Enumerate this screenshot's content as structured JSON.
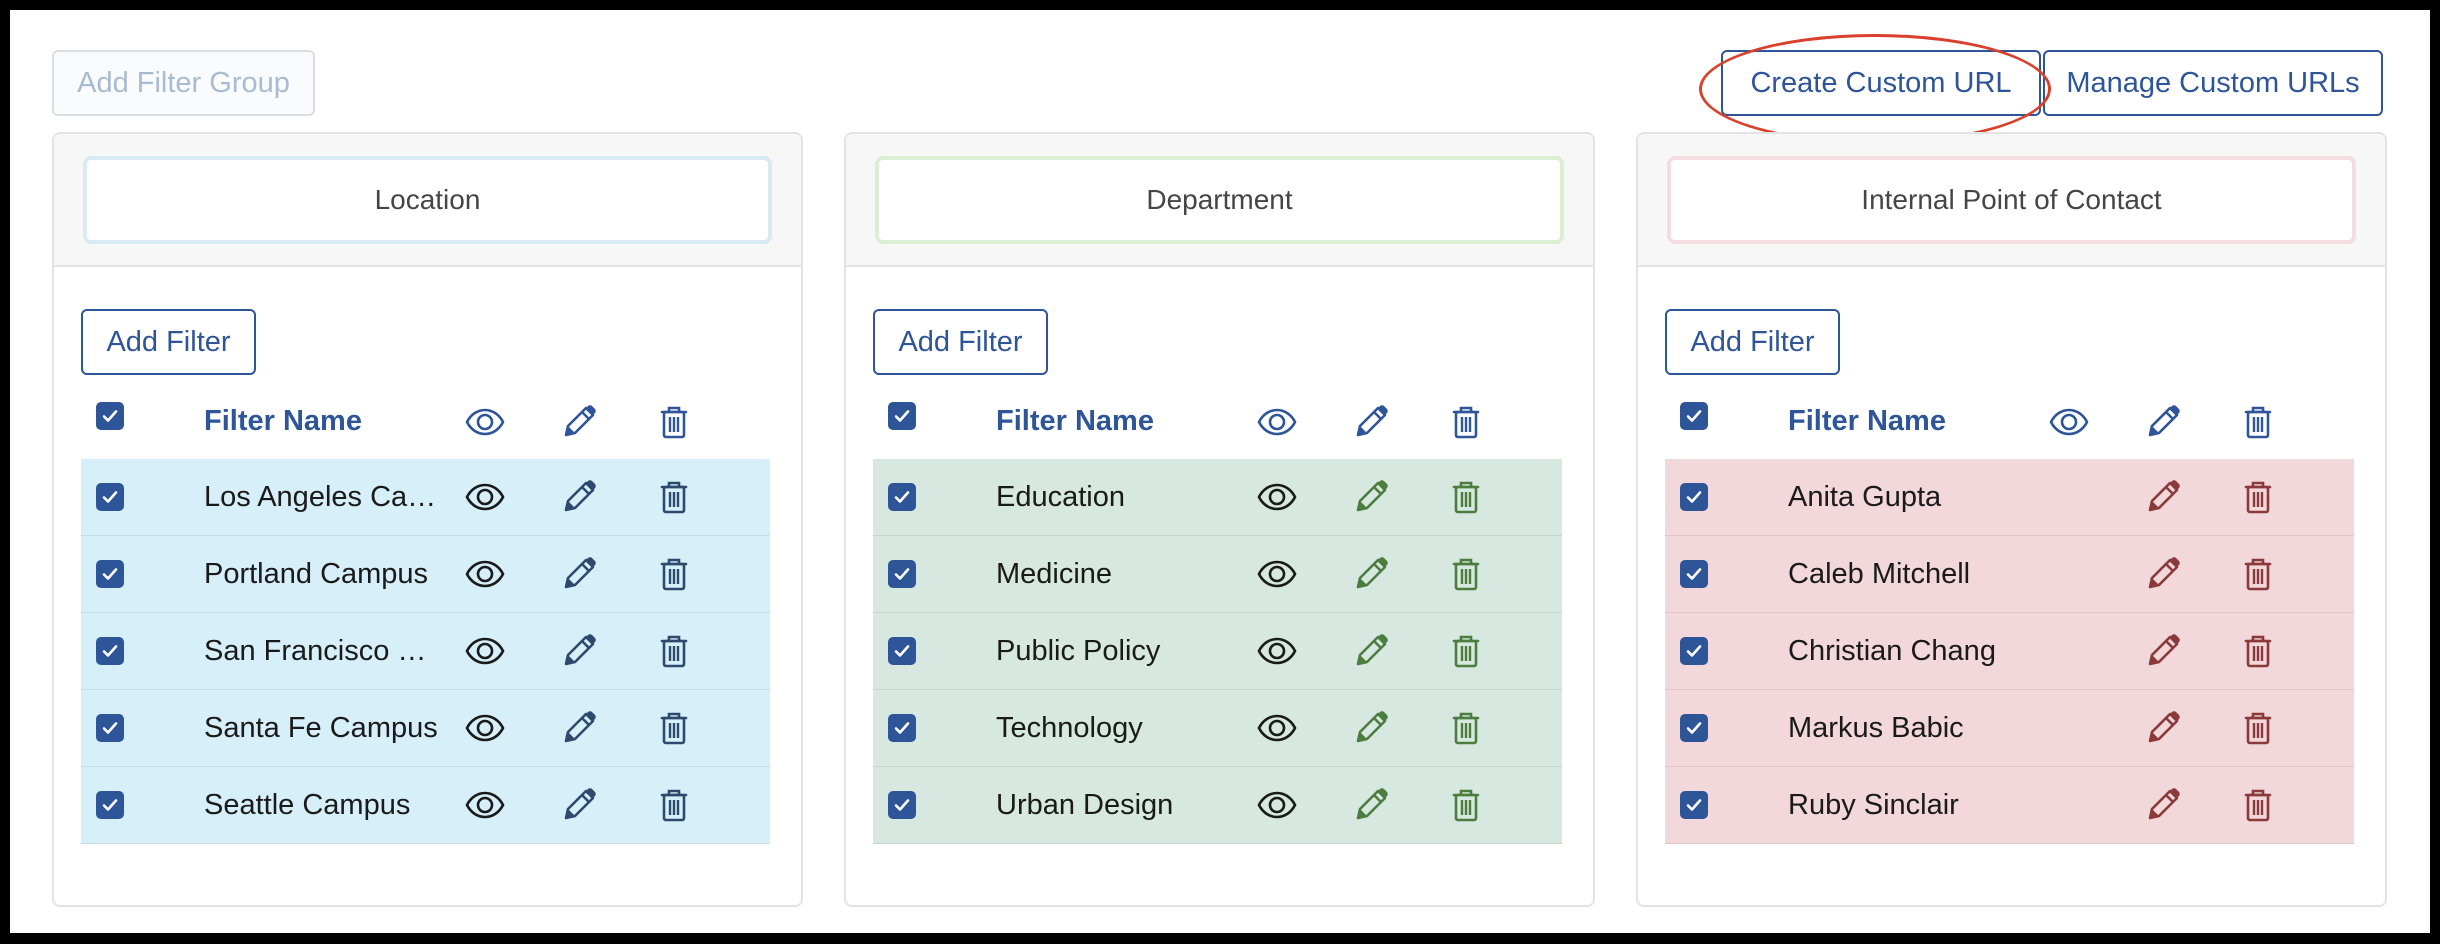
{
  "toolbar": {
    "add_filter_group_label": "Add Filter Group",
    "create_custom_url_label": "Create Custom URL",
    "manage_custom_urls_label": "Manage Custom URLs"
  },
  "table_header": {
    "filter_name": "Filter Name"
  },
  "groups": [
    {
      "name": "Location",
      "add_filter_label": "Add Filter",
      "row_color": "#d6eff8",
      "border_color": "#d8eaf6",
      "icon_color": "#2d4a6e",
      "filters": [
        {
          "name": "Los Angeles Campus"
        },
        {
          "name": "Portland Campus"
        },
        {
          "name": "San Francisco Campus"
        },
        {
          "name": "Santa Fe Campus"
        },
        {
          "name": "Seattle Campus"
        }
      ]
    },
    {
      "name": "Department",
      "add_filter_label": "Add Filter",
      "row_color": "#d6e8df",
      "border_color": "#dcefd4",
      "icon_color": "#4c7d3f",
      "filters": [
        {
          "name": "Education"
        },
        {
          "name": "Medicine"
        },
        {
          "name": "Public Policy"
        },
        {
          "name": "Technology"
        },
        {
          "name": "Urban Design"
        }
      ]
    },
    {
      "name": "Internal Point of Contact",
      "add_filter_label": "Add Filter",
      "row_color": "#f2d7db",
      "border_color": "#f3dde0",
      "icon_color": "#8a3a3a",
      "filters": [
        {
          "name": "Anita Gupta"
        },
        {
          "name": "Caleb Mitchell"
        },
        {
          "name": "Christian Chang"
        },
        {
          "name": "Markus Babic"
        },
        {
          "name": "Ruby Sinclair"
        }
      ]
    }
  ],
  "colors": {
    "primary": "#2d5598",
    "annotation": "#d9412c"
  }
}
